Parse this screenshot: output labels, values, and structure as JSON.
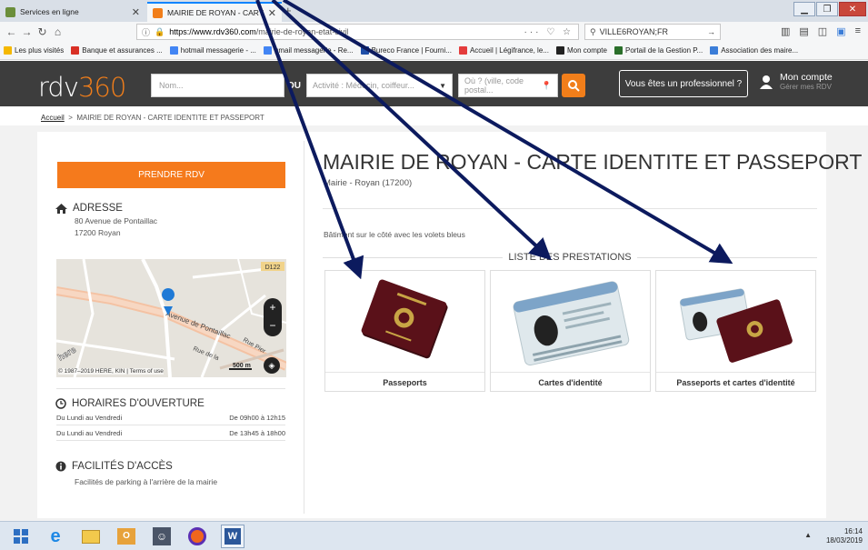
{
  "browser": {
    "tabs": [
      {
        "title": "Services en ligne",
        "active": false
      },
      {
        "title": "MAIRIE DE ROYAN - CARTE I",
        "active": true
      }
    ],
    "new_tab": "+",
    "url_host": "https://www.rdv360.com",
    "url_path": "/mairie-de-royan-etat-civil",
    "search_value": "VILLE6ROYAN;FR",
    "bookmarks": [
      {
        "label": "Les plus visités",
        "color": "#f5b800"
      },
      {
        "label": "Banque et assurances ...",
        "color": "#d93025"
      },
      {
        "label": "hotmail messagerie - ...",
        "color": "#4285f4"
      },
      {
        "label": "gmail messagerie - Re...",
        "color": "#4285f4"
      },
      {
        "label": "Bureco France | Fourni...",
        "color": "#1f4fa8"
      },
      {
        "label": "Accueil | Légifrance, le...",
        "color": "#e43c3c"
      },
      {
        "label": "Mon compte",
        "color": "#222222"
      },
      {
        "label": "Portail de la Gestion P...",
        "color": "#2a6f2a"
      },
      {
        "label": "Association des maire...",
        "color": "#3b7dd8"
      }
    ]
  },
  "header": {
    "logo_text_a": "rdv",
    "logo_text_b": "360",
    "name_placeholder": "Nom...",
    "ou_label": "OU",
    "activity_placeholder": "Activité : Médecin, coiffeur...",
    "where_placeholder": "Où ? (ville, code postal...",
    "pro_button": "Vous êtes un professionnel ?",
    "account_title": "Mon compte",
    "account_sub": "Gérer mes RDV"
  },
  "breadcrumb": {
    "home": "Accueil",
    "separator": ">",
    "current": "MAIRIE DE ROYAN - CARTE IDENTITE ET PASSEPORT"
  },
  "sidebar": {
    "rdv_button": "PRENDRE RDV",
    "address_heading": "ADRESSE",
    "address_line1": "80 Avenue de Pontaillac",
    "address_line2": "17200 Royan",
    "map_copyright": "© 1987–2019 HERE, KIN | Terms of use",
    "map_scale": "500 m",
    "map_labels": [
      "Avenue de Pontaillac",
      "Rue de la",
      "Rue Pier",
      "D122"
    ],
    "hours_heading": "HORAIRES D'OUVERTURE",
    "hours": [
      {
        "days": "Du Lundi au Vendredi",
        "time": "De 09h00 à 12h15"
      },
      {
        "days": "Du Lundi au Vendredi",
        "time": "De 13h45 à 18h00"
      }
    ],
    "access_heading": "FACILITÉS D'ACCÈS",
    "access_text": "Facilités de parking à l'arrière de la mairie"
  },
  "main": {
    "title": "MAIRIE DE ROYAN - CARTE IDENTITE ET PASSEPORT",
    "subtitle": "Mairie - Royan (17200)",
    "note": "Bâtiment sur le côté avec les volets bleus",
    "prestations_heading": "LISTE DES PRESTATIONS",
    "prestations": [
      {
        "label": "Passeports"
      },
      {
        "label": "Cartes d'identité"
      },
      {
        "label": "Passeports et cartes d'identité"
      }
    ]
  },
  "taskbar": {
    "time": "16:14",
    "date": "18/03/2019"
  },
  "colors": {
    "accent": "#f57a1c",
    "header_bg": "#3d3d3d",
    "arrow": "#0c1a5e"
  }
}
